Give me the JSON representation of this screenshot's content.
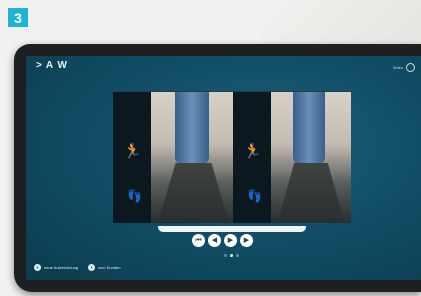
{
  "step_badge": "3",
  "app": {
    "logo": "A W",
    "logo_chevron": ">",
    "top_right_label": "Video"
  },
  "icons": {
    "runner": "runner-icon",
    "foot": "foot-icon"
  },
  "controls": [
    {
      "name": "skip-back-button",
      "glyph": "⏮"
    },
    {
      "name": "rewind-button",
      "glyph": "◀"
    },
    {
      "name": "play-button",
      "glyph": "▶"
    },
    {
      "name": "forward-button",
      "glyph": "▶"
    }
  ],
  "pagination": {
    "count": 3,
    "active": 1
  },
  "bottom_actions": [
    {
      "label": "neue Aufzeichnung"
    },
    {
      "label": "zum Kunden"
    }
  ],
  "colors": {
    "accent": "#1fb4d6",
    "screen_bg": "#0f4a61",
    "foot_blue": "#2f8fd3"
  }
}
